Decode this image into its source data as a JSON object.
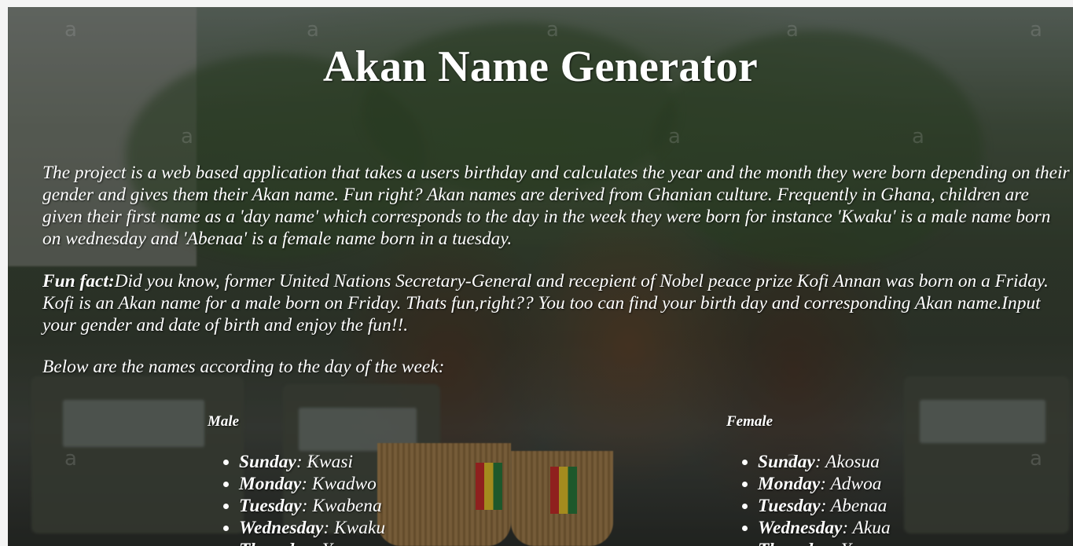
{
  "page": {
    "title": "Akan Name Generator",
    "intro": "The project is a web based application that takes a users birthday and calculates the year and the month they were born depending on their gender and gives them their Akan name. Fun right? Akan names are derived from Ghanian culture. Frequently in Ghana, children are given their first name as a 'day name' which corresponds to the day in the week they were born for instance 'Kwaku' is a male name born on wednesday and 'Abenaa' is a female name born in a tuesday.",
    "fun_fact_label": "Fun fact:",
    "fun_fact_text": "Did you know, former United Nations Secretary-General and recepient of Nobel peace prize Kofi Annan was born on a Friday. Kofi is an Akan name for a male born on Friday. Thats fun,right?? You too can find your birth day and corresponding Akan name.Input your gender and date of birth and enjoy the fun!!.",
    "list_intro": "Below are the names according to the day of the week:"
  },
  "background": {
    "watermark": "a"
  },
  "male": {
    "heading": "Male",
    "items": [
      {
        "day": "Sunday",
        "name": ": Kwasi"
      },
      {
        "day": "Monday",
        "name": ": Kwadwo"
      },
      {
        "day": "Tuesday",
        "name": ": Kwabena"
      },
      {
        "day": "Wednesday",
        "name": ": Kwaku"
      },
      {
        "day": "Thursday",
        "name": ": Yaw"
      }
    ]
  },
  "female": {
    "heading": "Female",
    "items": [
      {
        "day": "Sunday",
        "name": ": Akosua"
      },
      {
        "day": "Monday",
        "name": ": Adwoa"
      },
      {
        "day": "Tuesday",
        "name": ": Abenaa"
      },
      {
        "day": "Wednesday",
        "name": ": Akua"
      },
      {
        "day": "Thursday",
        "name": ": Yaa"
      }
    ]
  }
}
